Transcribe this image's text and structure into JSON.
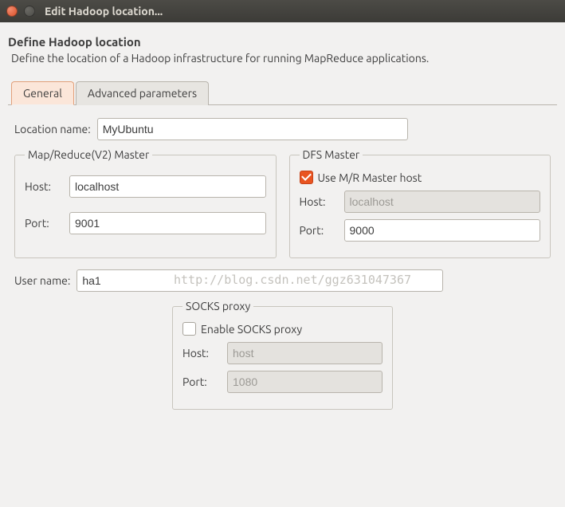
{
  "window": {
    "title": "Edit Hadoop location..."
  },
  "header": {
    "title": "Define Hadoop location",
    "subtitle": "Define the location of a Hadoop infrastructure for running MapReduce applications."
  },
  "tabs": {
    "general": "General",
    "advanced": "Advanced parameters"
  },
  "form": {
    "locationName": {
      "label": "Location name:",
      "value": "MyUbuntu"
    },
    "mrMaster": {
      "legend": "Map/Reduce(V2) Master",
      "hostLabel": "Host:",
      "hostValue": "localhost",
      "portLabel": "Port:",
      "portValue": "9001"
    },
    "dfsMaster": {
      "legend": "DFS Master",
      "useMrLabel": "Use M/R Master host",
      "hostLabel": "Host:",
      "hostPlaceholder": "localhost",
      "portLabel": "Port:",
      "portValue": "9000"
    },
    "userName": {
      "label": "User name:",
      "value": "ha1"
    },
    "socks": {
      "legend": "SOCKS proxy",
      "enableLabel": "Enable SOCKS proxy",
      "hostLabel": "Host:",
      "hostPlaceholder": "host",
      "portLabel": "Port:",
      "portPlaceholder": "1080"
    }
  },
  "watermark": "http://blog.csdn.net/ggz631047367"
}
